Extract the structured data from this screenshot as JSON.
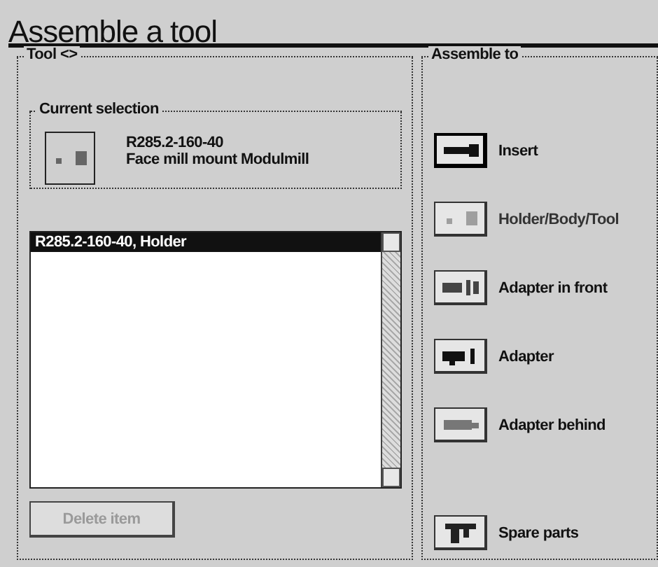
{
  "window": {
    "title": "Assemble a tool"
  },
  "tool_group": {
    "label": "Tool <>",
    "current_selection": {
      "label": "Current selection",
      "code": "R285.2-160-40",
      "description": "Face mill mount Modulmill"
    },
    "list": {
      "items": [
        {
          "text": "R285.2-160-40, Holder",
          "selected": true
        }
      ]
    },
    "delete_button": {
      "label": "Delete item",
      "disabled": true
    }
  },
  "assemble_group": {
    "label": "Assemble to",
    "buttons": [
      {
        "label": "Insert",
        "kind": "insert",
        "disabled": false,
        "default": true
      },
      {
        "label": "Holder/Body/Tool",
        "kind": "holder",
        "disabled": true,
        "default": false
      },
      {
        "label": "Adapter in front",
        "kind": "front",
        "disabled": false,
        "default": false
      },
      {
        "label": "Adapter",
        "kind": "adapter",
        "disabled": false,
        "default": false
      },
      {
        "label": "Adapter behind",
        "kind": "behind",
        "disabled": false,
        "default": false
      }
    ],
    "spare_parts": {
      "label": "Spare parts",
      "kind": "spare",
      "disabled": false,
      "default": false
    }
  }
}
